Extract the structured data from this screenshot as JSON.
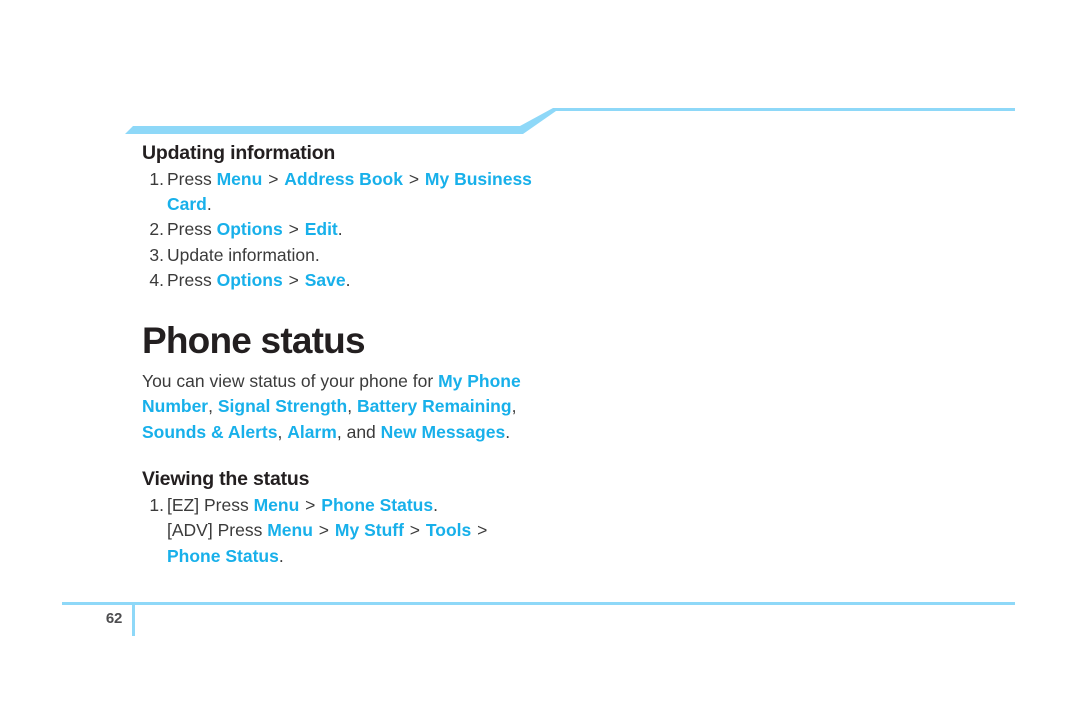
{
  "document": {
    "page_number": "62",
    "accent_band_color": "#8ed8f8",
    "accent_line_color": "#9ddcf8",
    "keyword_color": "#18b0ea",
    "body_text_color": "#3b3b3b",
    "heading_text_color": "#231f20",
    "footer_rule_color": "#8ed8f8"
  },
  "sections": [
    {
      "subheading": "Updating information",
      "steps": [
        {
          "marker": "1.",
          "line1": {
            "press": "Press",
            "kw1": "Menu",
            "sep1": ">",
            "kw2": "Address Book",
            "sep2": ">",
            "kw3": "My Business"
          },
          "line2": {
            "kw": "Card",
            "period": "."
          }
        },
        {
          "marker": "2.",
          "line1": {
            "press": "Press",
            "kw1": "Options",
            "sep1": ">",
            "kw2": "Edit",
            "period": "."
          }
        },
        {
          "marker": "3.",
          "line1": {
            "plain": "Update information."
          }
        },
        {
          "marker": "4.",
          "line1": {
            "press": "Press",
            "kw1": "Options",
            "sep1": ">",
            "kw2": "Save",
            "period": "."
          }
        }
      ]
    }
  ],
  "chapter": {
    "title": "Phone status",
    "intro": {
      "lead": "You can view status of your phone for ",
      "items": [
        "My Phone Number",
        "Signal Strength",
        "Battery Remaining",
        "Sounds & Alerts",
        "Alarm",
        "New Messages"
      ],
      "comma": ",",
      "and": "and",
      "period": "."
    },
    "viewing": {
      "subheading": "Viewing the status",
      "marker": "1.",
      "ez": {
        "tag": "[EZ]",
        "press": "Press",
        "kw1": "Menu",
        "sep1": ">",
        "kw2": "Phone Status",
        "period": "."
      },
      "adv": {
        "tag": "[ADV]",
        "press": "Press",
        "kw1": "Menu",
        "sep1": ">",
        "kw2": "My Stuff",
        "sep2": ">",
        "kw3": "Tools",
        "sep3": ">"
      },
      "adv_wrap": {
        "kw": "Phone Status",
        "period": "."
      }
    }
  }
}
